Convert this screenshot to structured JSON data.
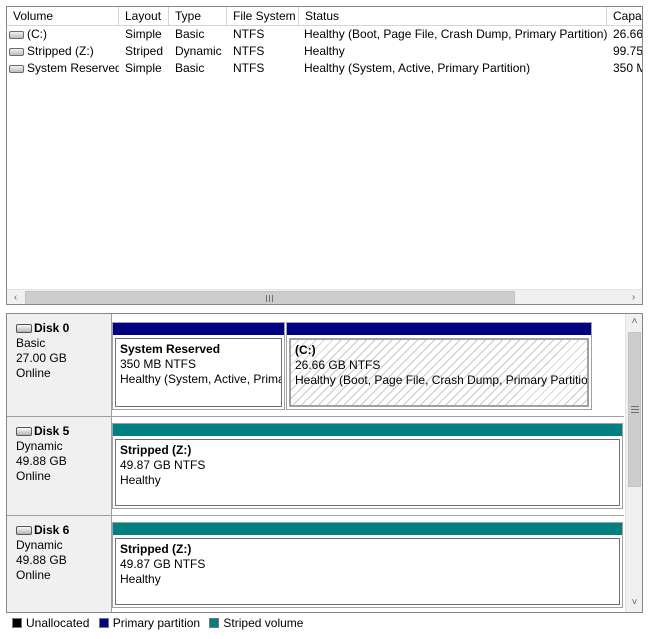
{
  "list": {
    "columns": [
      "Volume",
      "Layout",
      "Type",
      "File System",
      "Status",
      "Capa"
    ],
    "rows": [
      {
        "volume": "(C:)",
        "layout": "Simple",
        "type": "Basic",
        "fs": "NTFS",
        "status": "Healthy (Boot, Page File, Crash Dump, Primary Partition)",
        "capacity": "26.66"
      },
      {
        "volume": "Stripped (Z:)",
        "layout": "Striped",
        "type": "Dynamic",
        "fs": "NTFS",
        "status": "Healthy",
        "capacity": "99.75"
      },
      {
        "volume": "System Reserved",
        "layout": "Simple",
        "type": "Basic",
        "fs": "NTFS",
        "status": "Healthy (System, Active, Primary Partition)",
        "capacity": "350 M"
      }
    ],
    "scroll": {
      "left_arrow": "<",
      "right_arrow": ">",
      "grip": "III"
    }
  },
  "disks": [
    {
      "name": "Disk 0",
      "type": "Basic",
      "size": "27.00 GB",
      "status": "Online",
      "partitions": [
        {
          "name": "System Reserved",
          "size": "350 MB NTFS",
          "status": "Healthy (System, Active, Primary Partition)",
          "kind": "primary"
        },
        {
          "name": "(C:)",
          "size": "26.66 GB NTFS",
          "status": "Healthy (Boot, Page File, Crash Dump, Primary Partition)",
          "kind": "primary"
        }
      ]
    },
    {
      "name": "Disk 5",
      "type": "Dynamic",
      "size": "49.88 GB",
      "status": "Online",
      "partitions": [
        {
          "name": "Stripped  (Z:)",
          "size": "49.87 GB NTFS",
          "status": "Healthy",
          "kind": "striped"
        }
      ]
    },
    {
      "name": "Disk 6",
      "type": "Dynamic",
      "size": "49.88 GB",
      "status": "Online",
      "partitions": [
        {
          "name": "Stripped  (Z:)",
          "size": "49.87 GB NTFS",
          "status": "Healthy",
          "kind": "striped"
        }
      ]
    }
  ],
  "vscroll": {
    "up_arrow": "^",
    "down_arrow": "v"
  },
  "legend": [
    {
      "label": "Unallocated",
      "color": "#000000"
    },
    {
      "label": "Primary partition",
      "color": "#000080"
    },
    {
      "label": "Striped volume",
      "color": "#008080"
    }
  ],
  "colors": {
    "primary": "#000080",
    "striped": "#008080"
  }
}
